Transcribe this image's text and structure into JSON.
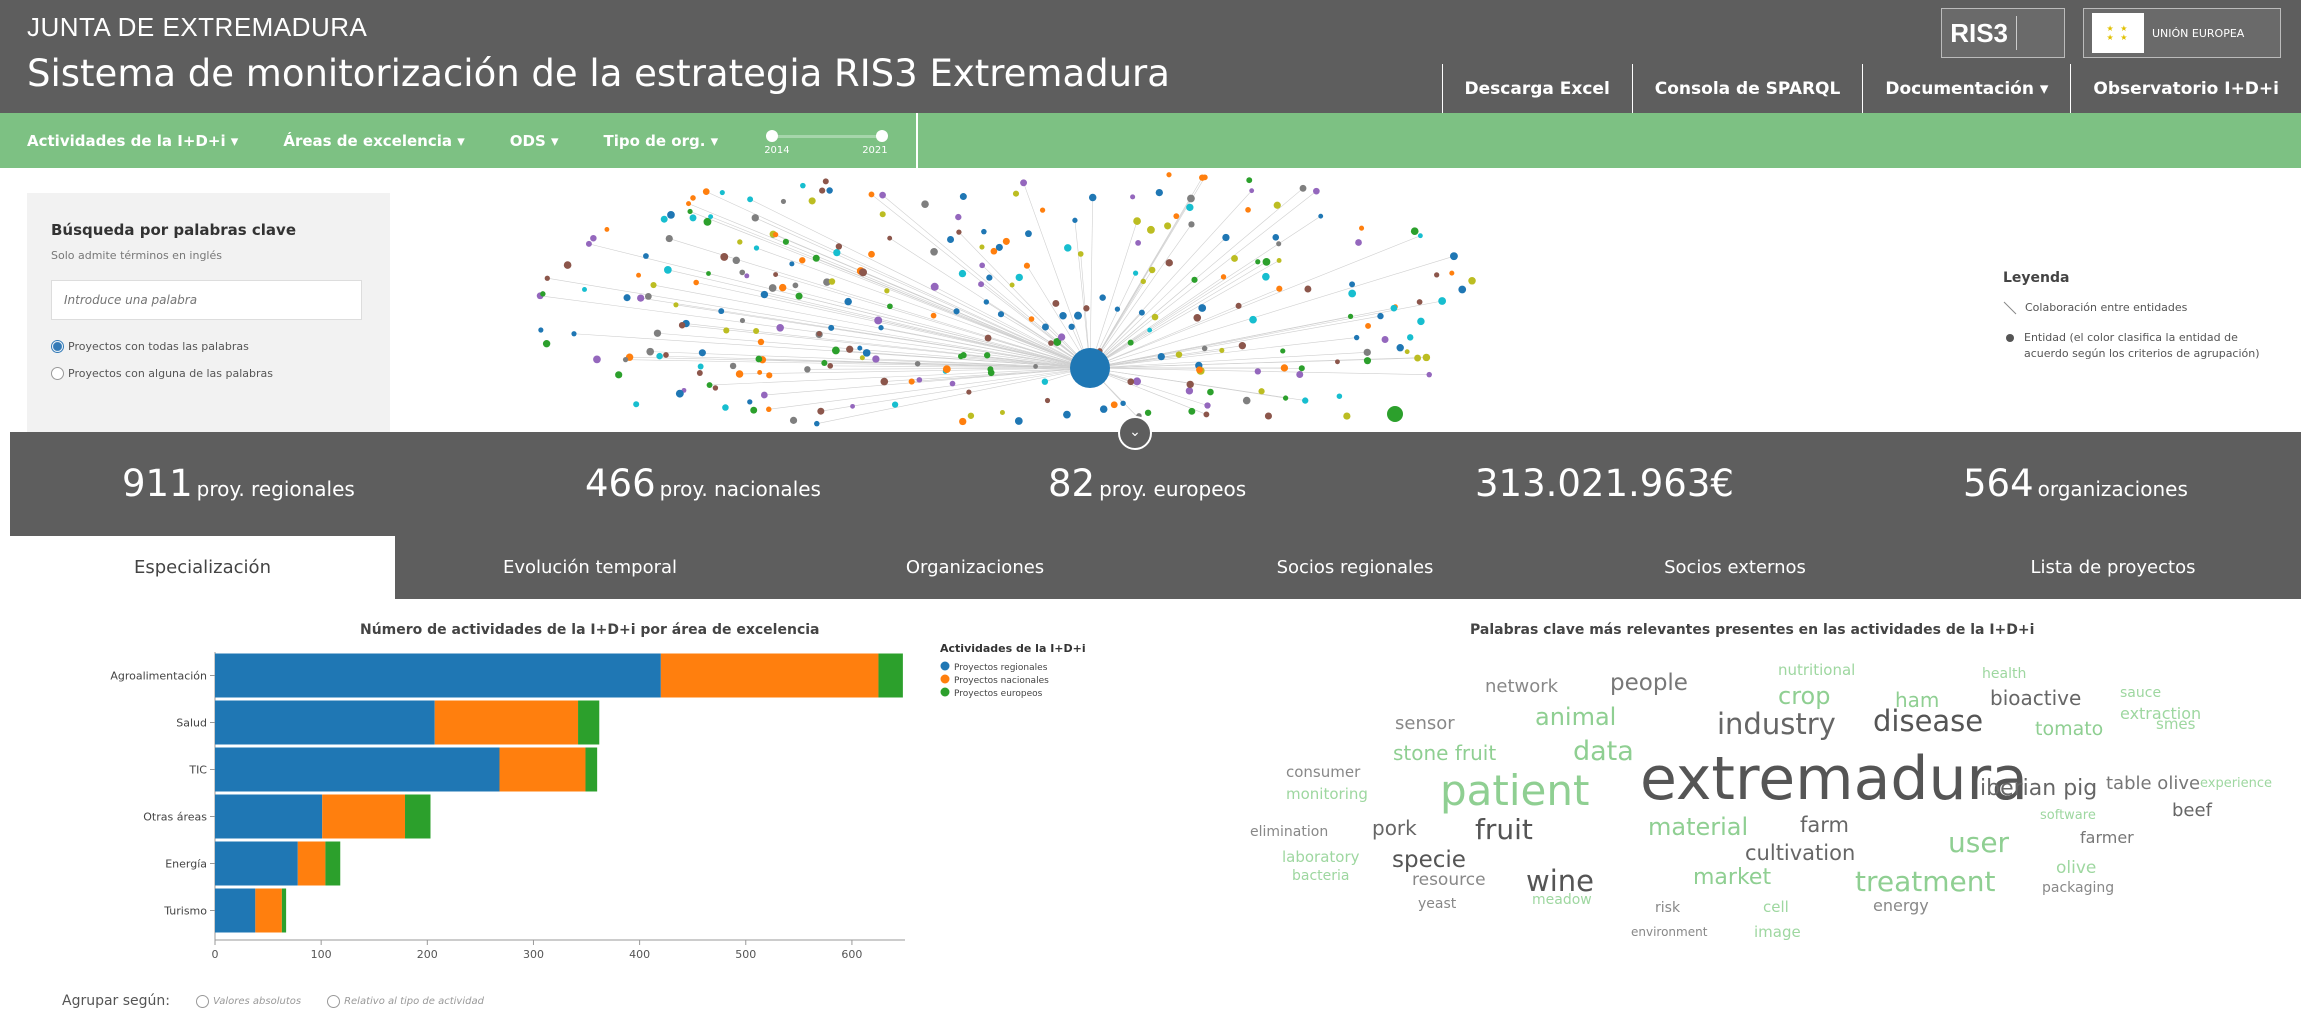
{
  "header": {
    "org": "JUNTA DE EXTREMADURA",
    "title": "Sistema de monitorización de la estrategia RIS3 Extremadura",
    "logo_ris3": "RIS3",
    "logo_eu_title": "UNIÓN EUROPEA",
    "nav": [
      "Descarga Excel",
      "Consola de SPARQL",
      "Documentación ▾",
      "Observatorio I+D+i"
    ]
  },
  "filters": {
    "items": [
      "Actividades de la I+D+i ▾",
      "Áreas de excelencia ▾",
      "ODS ▾",
      "Tipo de org. ▾"
    ],
    "year_min": "2014",
    "year_max": "2021"
  },
  "search": {
    "title": "Búsqueda por palabras clave",
    "subtitle": "Solo admite términos en inglés",
    "placeholder": "Introduce una palabra",
    "opt_all": "Proyectos con todas las palabras",
    "opt_any": "Proyectos con alguna de las palabras"
  },
  "legend": {
    "title": "Leyenda",
    "edge": "Colaboración entre entidades",
    "node": "Entidad (el color clasifica la entidad de acuerdo según los criterios de agrupación)"
  },
  "stats": [
    {
      "num": "911",
      "label": "proy. regionales"
    },
    {
      "num": "466",
      "label": "proy. nacionales"
    },
    {
      "num": "82",
      "label": "proy. europeos"
    },
    {
      "num": "313.021.963€",
      "label": ""
    },
    {
      "num": "564",
      "label": "organizaciones"
    }
  ],
  "tabs": [
    "Especialización",
    "Evolución temporal",
    "Organizaciones",
    "Socios regionales",
    "Socios externos",
    "Lista de proyectos"
  ],
  "chart_data": {
    "type": "bar",
    "orientation": "horizontal",
    "stacked": true,
    "title": "Número de actividades de la I+D+i por área de excelencia",
    "legend_title": "Actividades de la I+D+i",
    "legend_position": "top-right",
    "categories": [
      "Agroalimentación",
      "Salud",
      "TIC",
      "Otras áreas",
      "Energía",
      "Turismo"
    ],
    "series": [
      {
        "name": "Proyectos regionales",
        "color": "#1f77b4",
        "values": [
          420,
          207,
          268,
          101,
          78,
          38
        ]
      },
      {
        "name": "Proyectos nacionales",
        "color": "#ff7f0e",
        "values": [
          205,
          135,
          81,
          78,
          26,
          25
        ]
      },
      {
        "name": "Proyectos europeos",
        "color": "#2ca02c",
        "values": [
          23,
          20,
          11,
          24,
          14,
          4
        ]
      }
    ],
    "xticks": [
      0,
      100,
      200,
      300,
      400,
      500,
      600
    ],
    "xlim": [
      0,
      650
    ]
  },
  "group_by": {
    "label": "Agrupar según:",
    "opt_abs": "Valores absolutos",
    "opt_rel": "Relativo al tipo de actividad"
  },
  "cloud": {
    "title": "Palabras clave más relevantes presentes en las actividades de la I+D+i",
    "words": [
      {
        "text": "nutritional",
        "color": "#9ed7a0"
      },
      {
        "text": "health",
        "color": "#9ed7a0"
      },
      {
        "text": "network",
        "color": "#888888"
      },
      {
        "text": "people",
        "color": "#777777"
      },
      {
        "text": "crop",
        "color": "#8fcf92"
      },
      {
        "text": "ham",
        "color": "#8fcf92"
      },
      {
        "text": "bioactive",
        "color": "#666666"
      },
      {
        "text": "sauce",
        "color": "#9ed7a0"
      },
      {
        "text": "extraction",
        "color": "#9ed7a0"
      },
      {
        "text": "animal",
        "color": "#8fcf92"
      },
      {
        "text": "sensor",
        "color": "#888888"
      },
      {
        "text": "industry",
        "color": "#666666"
      },
      {
        "text": "disease",
        "color": "#555555"
      },
      {
        "text": "tomato",
        "color": "#8fcf92"
      },
      {
        "text": "smes",
        "color": "#9ed7a0"
      },
      {
        "text": "stone fruit",
        "color": "#8fcf92"
      },
      {
        "text": "data",
        "color": "#8fcf92"
      },
      {
        "text": "consumer",
        "color": "#888888"
      },
      {
        "text": "extremadura",
        "color": "#555555"
      },
      {
        "text": "iberian pig",
        "color": "#666666"
      },
      {
        "text": "table olive",
        "color": "#777777"
      },
      {
        "text": "experience",
        "color": "#9ed7a0"
      },
      {
        "text": "monitoring",
        "color": "#9ed7a0"
      },
      {
        "text": "patient",
        "color": "#8fcf92"
      },
      {
        "text": "beef",
        "color": "#666666"
      },
      {
        "text": "software",
        "color": "#9ed7a0"
      },
      {
        "text": "elimination",
        "color": "#888888"
      },
      {
        "text": "pork",
        "color": "#666666"
      },
      {
        "text": "fruit",
        "color": "#555555"
      },
      {
        "text": "material",
        "color": "#8fcf92"
      },
      {
        "text": "farm",
        "color": "#666666"
      },
      {
        "text": "user",
        "color": "#8fcf92"
      },
      {
        "text": "farmer",
        "color": "#777777"
      },
      {
        "text": "cultivation",
        "color": "#666666"
      },
      {
        "text": "laboratory",
        "color": "#9ed7a0"
      },
      {
        "text": "specie",
        "color": "#555555"
      },
      {
        "text": "olive",
        "color": "#9ed7a0"
      },
      {
        "text": "bacteria",
        "color": "#9ed7a0"
      },
      {
        "text": "resource",
        "color": "#888888"
      },
      {
        "text": "wine",
        "color": "#555555"
      },
      {
        "text": "market",
        "color": "#8fcf92"
      },
      {
        "text": "treatment",
        "color": "#8fcf92"
      },
      {
        "text": "packaging",
        "color": "#888888"
      },
      {
        "text": "meadow",
        "color": "#9ed7a0"
      },
      {
        "text": "yeast",
        "color": "#888888"
      },
      {
        "text": "risk",
        "color": "#888888"
      },
      {
        "text": "cell",
        "color": "#9ed7a0"
      },
      {
        "text": "energy",
        "color": "#888888"
      },
      {
        "text": "environment",
        "color": "#888888"
      },
      {
        "text": "image",
        "color": "#9ed7a0"
      }
    ]
  }
}
